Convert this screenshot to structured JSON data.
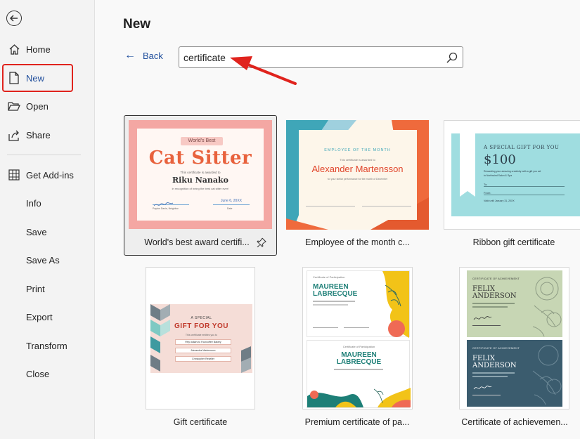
{
  "sidebar": {
    "items": [
      {
        "label": "Home"
      },
      {
        "label": "New"
      },
      {
        "label": "Open"
      },
      {
        "label": "Share"
      },
      {
        "label": "Get Add-ins"
      },
      {
        "label": "Info"
      },
      {
        "label": "Save"
      },
      {
        "label": "Save As"
      },
      {
        "label": "Print"
      },
      {
        "label": "Export"
      },
      {
        "label": "Transform"
      },
      {
        "label": "Close"
      }
    ],
    "active_item": "New"
  },
  "main": {
    "title": "New",
    "back_label": "Back",
    "search_value": "certificate"
  },
  "templates": [
    {
      "caption": "World's best award certifi...",
      "thumb": {
        "badge": "World's Best",
        "title": "Cat Sitter",
        "line1": "This certificate is awarded to",
        "name": "Riku Nanako",
        "line2": "in recognition of being the best cat sitter ever!",
        "date": "June 6, 20XX",
        "sign_name": "Payton Davis, Neighbor",
        "date_label": "Date"
      }
    },
    {
      "caption": "Employee of the month c...",
      "thumb": {
        "heading": "EMPLOYEE OF THE MONTH",
        "line1": "This certificate is awarded to",
        "name": "Alexander Martensson",
        "line2": "for your stellar performance for the month of December"
      }
    },
    {
      "caption": "Ribbon gift certificate",
      "thumb": {
        "heading": "A SPECIAL GIFT FOR YOU",
        "amount": "$100",
        "line1": "Rewarding your amazing creativity with a gift you sel",
        "line2": "to Northwind Salon & Spa",
        "to_label": "To:",
        "from_label": "From:",
        "valid": "Valid until January 31, 20XX"
      }
    },
    {
      "caption": "Gift certificate",
      "thumb": {
        "small": "A SPECIAL",
        "title": "GIFT FOR YOU",
        "line1": "This certificate entitles you to",
        "field1": "Fifty dollars to Fourcoffee Bakery",
        "field2": "Alexandra Martensson",
        "field3": "Christopher Reseller"
      }
    },
    {
      "caption": "Premium certificate of pa...",
      "thumb": {
        "heading": "Certificate of Participation",
        "name1": "MAUREEN",
        "name2": "LABRECQUE"
      }
    },
    {
      "caption": "Certificate of achievemen...",
      "thumb": {
        "heading": "CERTIFICATE OF ACHIEVEMENT",
        "name1": "FELIX",
        "name2": "ANDERSON"
      }
    }
  ],
  "colors": {
    "accent_blue": "#1f4e9c",
    "highlight_red": "#e0231d",
    "cat_pink": "#f4a7a3",
    "cat_title": "#e8623d",
    "emp_teal": "#3fa6b8",
    "emp_orange": "#ef6a3c",
    "ribbon_teal": "#9fdde0",
    "gift_pink": "#f5ddd7",
    "premium_yellow": "#f2c318",
    "achieve_green": "#c7d6b4",
    "achieve_dark": "#3b5c6e"
  }
}
